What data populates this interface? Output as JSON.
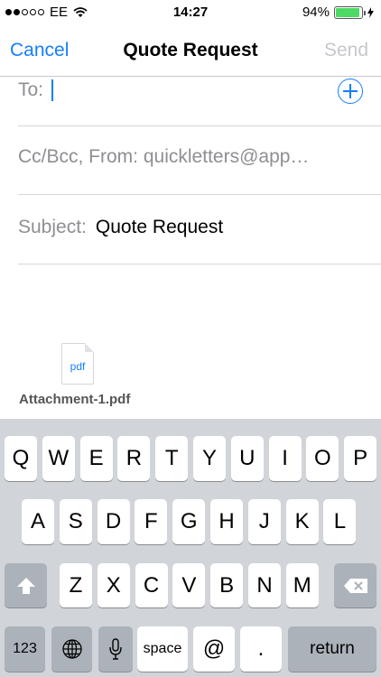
{
  "status_bar": {
    "carrier": "EE",
    "time": "14:27",
    "battery_percent": "94%",
    "battery_level": 0.94,
    "signal_bars_filled": 2,
    "signal_bars_total": 5
  },
  "nav": {
    "cancel_label": "Cancel",
    "title": "Quote Request",
    "send_label": "Send"
  },
  "compose": {
    "to_label": "To:",
    "cc_label": "Cc/Bcc, From:",
    "from_value": "quickletters@app…",
    "subject_label": "Subject:",
    "subject_value": "Quote Request"
  },
  "attachment": {
    "icon_text": "pdf",
    "file_name": "Attachment-1.pdf"
  },
  "keyboard": {
    "row1": [
      "Q",
      "W",
      "E",
      "R",
      "T",
      "Y",
      "U",
      "I",
      "O",
      "P"
    ],
    "row2": [
      "A",
      "S",
      "D",
      "F",
      "G",
      "H",
      "J",
      "K",
      "L"
    ],
    "row3": [
      "Z",
      "X",
      "C",
      "V",
      "B",
      "N",
      "M"
    ],
    "numbers_label": "123",
    "space_label": "space",
    "at_label": "@",
    "dot_label": ".",
    "return_label": "return"
  },
  "colors": {
    "accent": "#157efb",
    "send_disabled": "#c7c7cc",
    "keyboard_bg": "#d1d4d9",
    "battery": "#4cd964"
  }
}
